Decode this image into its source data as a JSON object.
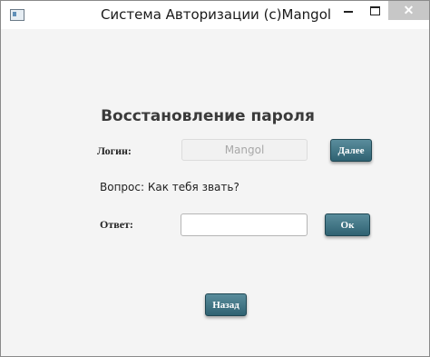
{
  "window": {
    "title": "Система Авторизации (c)Mangol",
    "close_glyph": "✕"
  },
  "form": {
    "heading": "Восстановление пароля",
    "login_label": "Логин:",
    "login_value": "Mangol",
    "next_button": "Далее",
    "question": "Вопрос: Как тебя звать?",
    "answer_label": "Ответ:",
    "answer_value": "",
    "ok_button": "Ок",
    "back_button": "Назад"
  }
}
